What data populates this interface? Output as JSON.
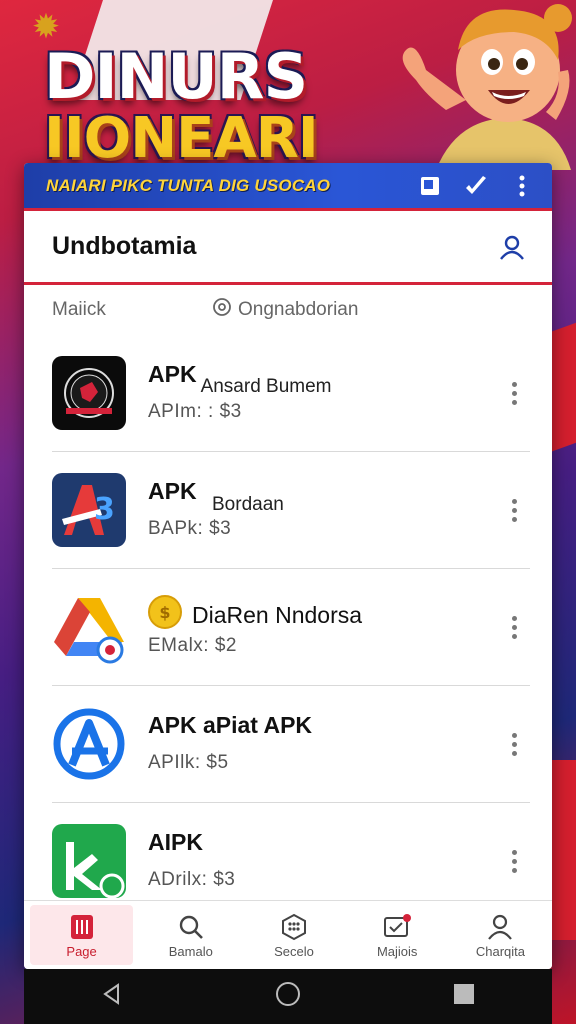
{
  "banner": {
    "title_line1": "DINURS",
    "title_line2": "IIONEARI",
    "emblem": "garuda-emblem"
  },
  "topbar": {
    "text": "NAIARI PIKC TUNTA DIG USOCAO",
    "icons": [
      "square-icon",
      "pen-icon",
      "more-vertical-icon"
    ]
  },
  "header": {
    "title": "Undbotamia",
    "user_icon": "user-icon"
  },
  "filters": {
    "left": "Maiick",
    "right": "Ongnabdorian",
    "right_icon": "circle-settings-icon"
  },
  "items": [
    {
      "name": "APK",
      "desc": "Ansard Bumem",
      "price": "APIm: : $3"
    },
    {
      "name": "APK",
      "desc": "Bordaan",
      "price": "BAPk: $3"
    },
    {
      "name": "DiaRen Nndorsa",
      "desc": "",
      "price": "EMalx: $2"
    },
    {
      "name": "APK aPiat APK",
      "desc": "",
      "price": "APIlk: $5"
    },
    {
      "name": "AIPK",
      "desc": "",
      "price": "ADrilx: $3"
    }
  ],
  "bottomnav": [
    {
      "label": "Page",
      "icon": "page-icon",
      "active": true
    },
    {
      "label": "Bamalo",
      "icon": "search-icon",
      "active": false
    },
    {
      "label": "Secelo",
      "icon": "grid-icon",
      "active": false
    },
    {
      "label": "Majiois",
      "icon": "message-icon",
      "active": false
    },
    {
      "label": "Charqita",
      "icon": "profile-icon",
      "active": false
    }
  ],
  "colors": {
    "accent_red": "#d4233a",
    "topbar_blue": "#2a56d6",
    "topbar_text": "#ffd43a"
  }
}
